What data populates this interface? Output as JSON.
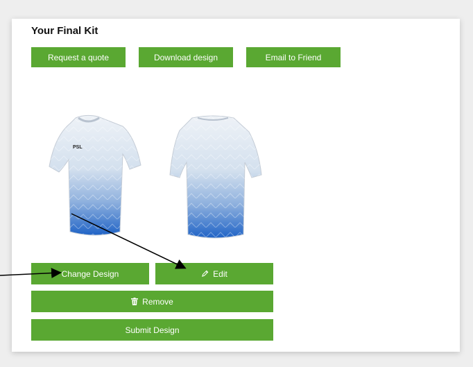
{
  "kit": {
    "title": "Your Final Kit",
    "actions": {
      "request_quote": "Request a quote",
      "download_design": "Download design",
      "email_friend": "Email to Friend"
    },
    "shirt_logo": "PSL",
    "controls": {
      "change_design": "Change Design",
      "edit": "Edit",
      "remove": "Remove",
      "submit_design": "Submit Design"
    }
  },
  "colors": {
    "button_green": "#5aa832",
    "shirt_light": "#e6ecf3",
    "shirt_dark": "#1f63c6"
  },
  "icons": {
    "edit": "pencil-icon",
    "remove": "trash-icon"
  }
}
